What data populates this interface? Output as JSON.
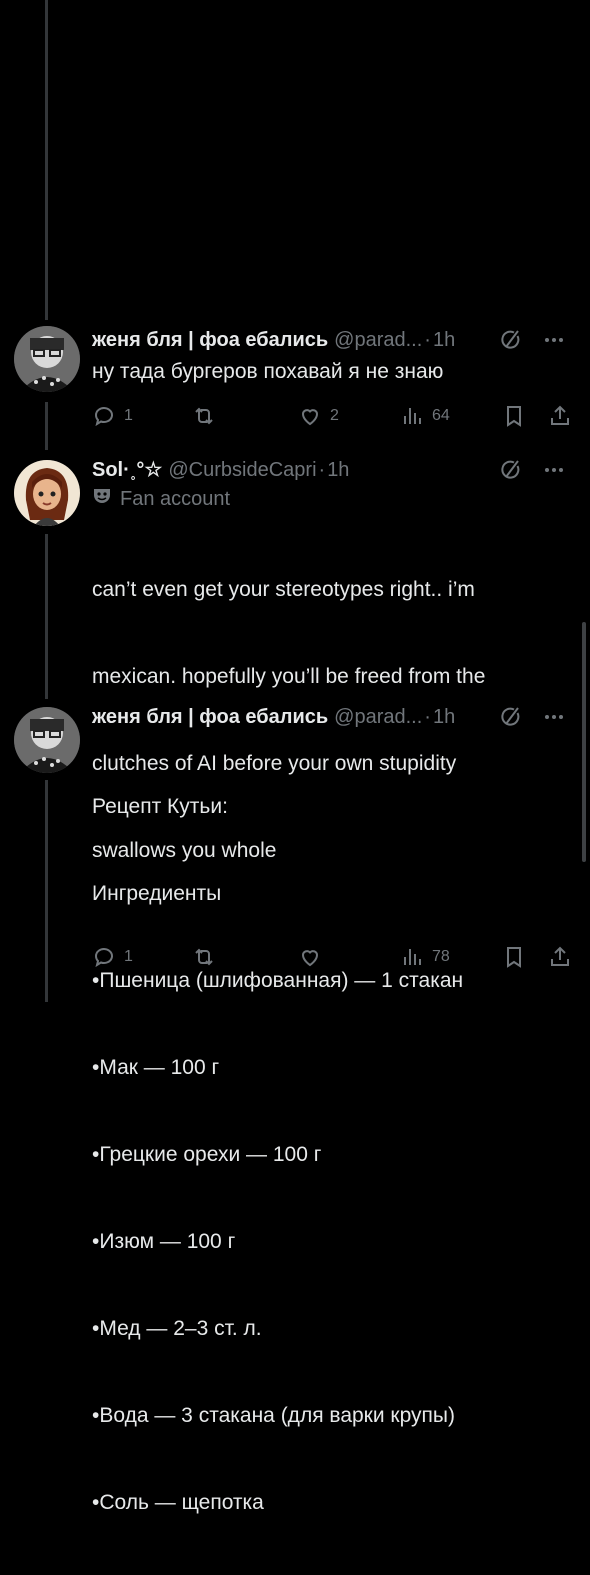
{
  "tweets": [
    {
      "name": "женя бля | фоа ебались",
      "handle": "@parad...",
      "time": "1h",
      "text": "ну тада бургеров похавай я не знаю",
      "replies": "1",
      "retweets": "",
      "likes": "2",
      "views": "64"
    },
    {
      "name": "Sol·˳°☆",
      "handle": "@CurbsideCapri",
      "time": "1h",
      "badge": "Fan account",
      "text_lines": [
        "can’t even get your stereotypes right.. i’m",
        "mexican. hopefully you’ll be freed from the",
        "clutches of AI before your own stupidity",
        "swallows you whole"
      ],
      "replies": "1",
      "retweets": "",
      "likes": "",
      "views": "78"
    },
    {
      "name": "женя бля | фоа ебались",
      "handle": "@parad...",
      "time": "1h",
      "text_lines": [
        "Рецепт Кутьи:",
        "Ингредиенты",
        "•Пшеница (шлифованная) — 1 стакан",
        "•Мак — 100 г",
        "•Грецкие орехи — 100 г",
        "•Изюм — 100 г",
        "•Мед — 2–3 ст. л.",
        "•Вода — 3 стакана (для варки крупы)",
        "•Соль — щепотка"
      ]
    }
  ],
  "icons": {
    "reply": "reply-icon",
    "retweet": "retweet-icon",
    "like": "heart-icon",
    "views": "views-icon",
    "bookmark": "bookmark-icon",
    "share": "share-icon",
    "grok": "grok-icon",
    "more": "more-icon",
    "fan": "fan-account-icon"
  },
  "colors": {
    "background": "#000000",
    "text": "#e7e9ea",
    "muted": "#71767b",
    "line": "#333639"
  }
}
